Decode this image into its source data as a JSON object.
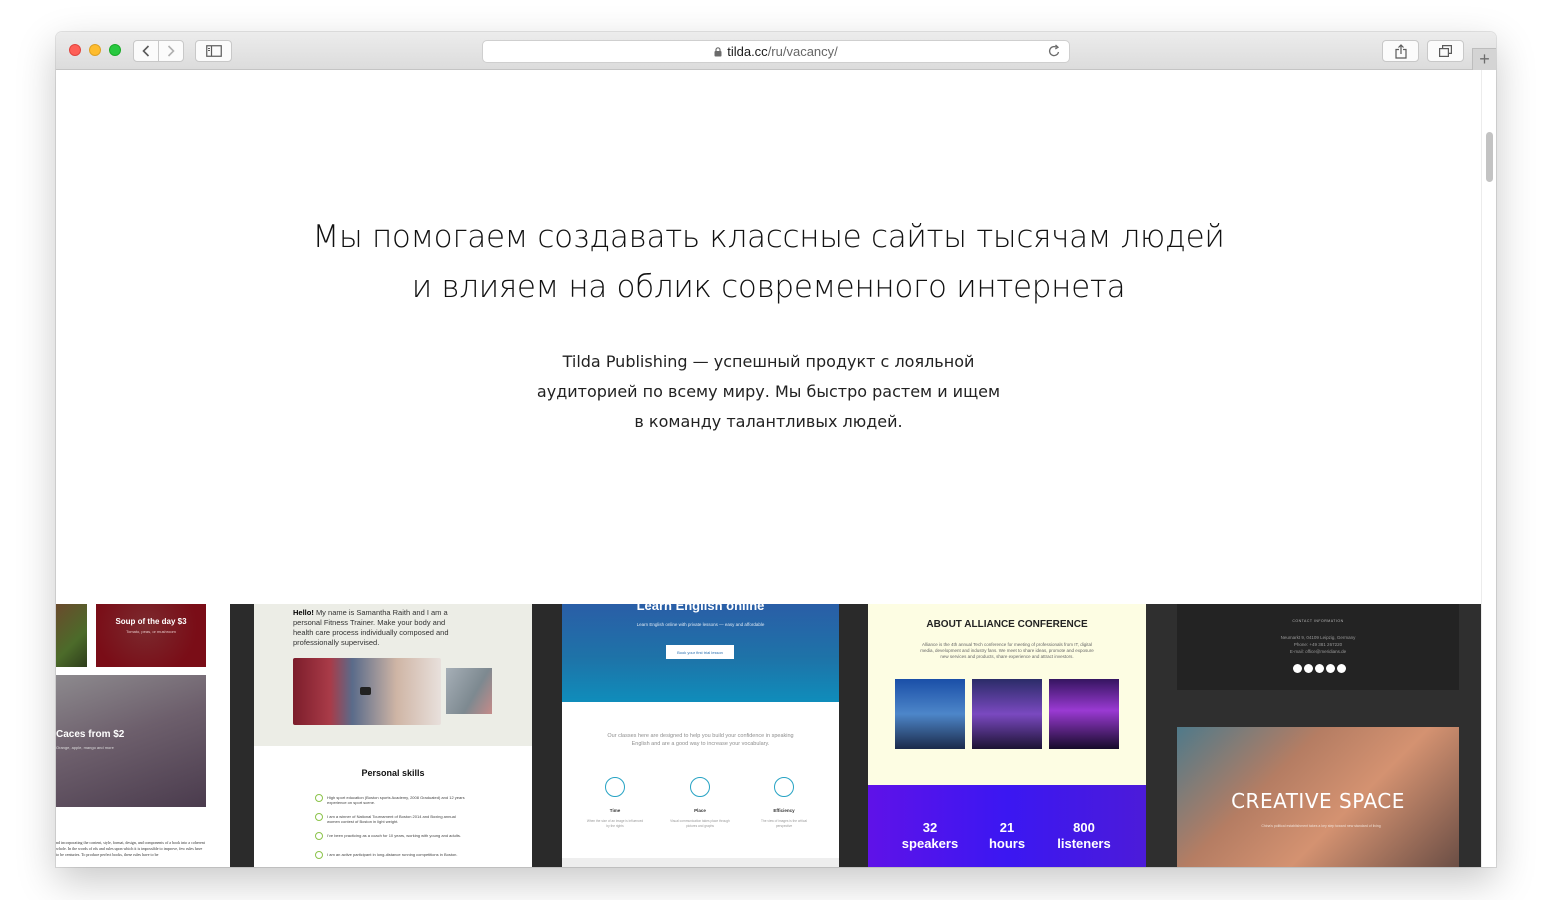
{
  "browser": {
    "url_host": "tilda.cc",
    "url_path": "/ru/vacancy/",
    "icons": [
      "back-icon",
      "forward-icon",
      "sidebar-icon",
      "lock-icon",
      "reload-icon",
      "share-icon",
      "tabs-icon",
      "plus-icon"
    ],
    "new_tab_symbol": "+"
  },
  "page": {
    "headline_line1": "Мы помогаем создавать классные сайты тысячам людей",
    "headline_line2": "и влияем на облик современного интернета",
    "sub_line1": "Tilda Publishing — успешный продукт с лояльной",
    "sub_line2": "аудиторией по всему миру. Мы быстро растем и ищем",
    "sub_line3": "в команду талантливых людей."
  },
  "gallery": {
    "food": {
      "soup_title": "Soup of the day $3",
      "soup_sub": "Tomato, peas, or mushroom",
      "macaron_title": "Caces from $2",
      "macaron_sub": "Orange, apple, mango and more",
      "body_text": "nd incorporating the content, style, format, design, and components of a book into a coherent whole. In the words of rds and rules upon which it is impossible to improve, few rules have to be centuries. To produce perfect books, these rules have to be"
    },
    "fitness": {
      "hello": "Hello!",
      "intro": "My name is Samantha Raith and I am a personal Fitness Trainer. Make your body and health care process individually composed and professionally supervised.",
      "skills_title": "Personal skills",
      "skills": [
        "High sport education (Boston sports Academy, 2008 Graduated) and 12 years experience on sport scene.",
        "I am a winner of National Tournament of Boston 2014 and Boxing annual women contest of Boston in light weight.",
        "I've been practicing as a coach for 10 years, working with young and adults.",
        "I am an active participant in long-distance running competitions in Boston."
      ]
    },
    "english": {
      "title": "Learn English online",
      "subtitle": "Learn English online with private lessons — easy and affordable",
      "button": "Book your first trial lesson",
      "lead": "Our classes here are designed to help you build your confidence in speaking English and are a good way to increase your vocabulary.",
      "features": [
        {
          "label": "Time",
          "desc": "When the size of an image is influenced by the rights",
          "icon": "clock-icon"
        },
        {
          "label": "Place",
          "desc": "Visual communication takes place through pictures and graphs",
          "icon": "place-icon"
        },
        {
          "label": "Efficiency",
          "desc": "The view of images is the critical perspective",
          "icon": "chart-icon"
        }
      ]
    },
    "conference": {
      "title": "ABOUT ALLIANCE CONFERENCE",
      "desc": "Alliance is the 4th annual Tech conference for meeting of professionals from IT, digital media, development and industry fans. We meet to share ideas, promote and exposure new services and products, share experience and attract investors.",
      "stats": [
        {
          "num": "32",
          "unit": "speakers"
        },
        {
          "num": "21",
          "unit": "hours"
        },
        {
          "num": "800",
          "unit": "listeners"
        }
      ]
    },
    "creative": {
      "contact_title": "CONTACT INFORMATION",
      "address": "Neumarkt 9, 04109 Leipzig, Germany",
      "phone": "Phone: +49 381 267220",
      "email": "E-mail: office@meridians.de",
      "banner": "CREATIVE SPACE",
      "banner_sub": "China's political establishment takes a key step toward new standard of living"
    }
  },
  "colors": {
    "toolbar": "#dcdcdc",
    "headline": "#111111",
    "soup": "#7a0d17",
    "english_hero": "#1e73a8",
    "conference_bg": "#fdfde3",
    "conference_stats": "#4a16ef",
    "skill_check": "#8bc34a"
  }
}
